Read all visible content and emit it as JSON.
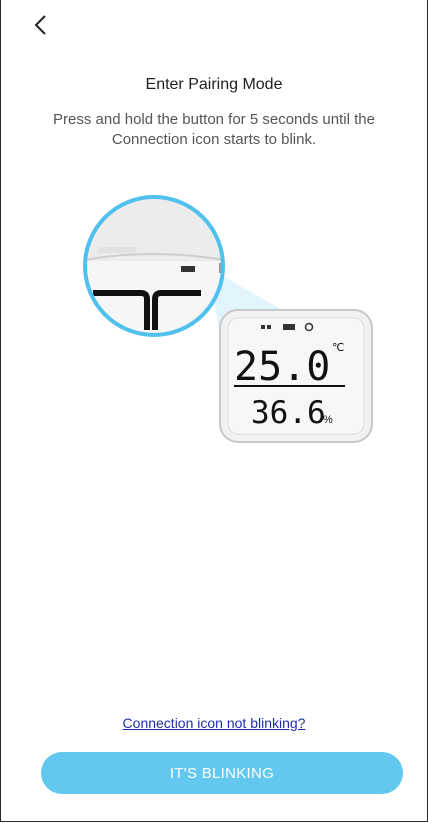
{
  "header": {
    "back_icon": "chevron-left-icon"
  },
  "page": {
    "title": "Enter Pairing Mode",
    "instructions": "Press and hold the button for 5 seconds until the Connection icon starts to blink."
  },
  "device": {
    "temperature": "25.0",
    "temperature_unit": "℃",
    "humidity": "36.6",
    "humidity_unit": "%"
  },
  "footer": {
    "help_link": "Connection icon not blinking?",
    "primary_button": "IT'S BLINKING"
  },
  "colors": {
    "accent": "#62c8f0",
    "link": "#1d2fa8",
    "zoom_ring": "#4fc1ec"
  }
}
